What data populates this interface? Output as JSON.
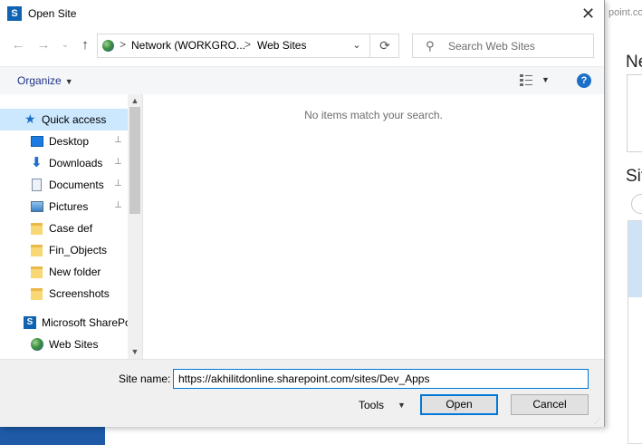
{
  "background": {
    "url_fragment": "point.co",
    "heading_1": "Ne",
    "heading_2": "Sit"
  },
  "dialog": {
    "title": "Open Site",
    "close_glyph": "✕"
  },
  "navigation": {
    "back_glyph": "←",
    "forward_glyph": "→",
    "recent_glyph": "⌄",
    "up_glyph": "↑",
    "breadcrumbs": [
      "Network (WORKGRO...",
      "Web Sites"
    ],
    "separator": ">",
    "refresh_glyph": "⟳",
    "search_placeholder": "Search Web Sites"
  },
  "toolbar": {
    "organize_label": "Organize",
    "help_label": "?"
  },
  "sidebar": {
    "items": [
      {
        "label": "Quick access",
        "icon": "star-icon"
      },
      {
        "label": "Desktop",
        "icon": "desktop-icon"
      },
      {
        "label": "Downloads",
        "icon": "download-icon"
      },
      {
        "label": "Documents",
        "icon": "document-icon"
      },
      {
        "label": "Pictures",
        "icon": "pictures-icon"
      },
      {
        "label": "Case def",
        "icon": "folder-icon"
      },
      {
        "label": "Fin_Objects",
        "icon": "folder-icon"
      },
      {
        "label": "New folder",
        "icon": "folder-icon"
      },
      {
        "label": "Screenshots",
        "icon": "folder-icon"
      },
      {
        "label": "Microsoft SharePo",
        "icon": "sharepoint-icon"
      },
      {
        "label": "Web Sites",
        "icon": "globe-icon"
      }
    ],
    "pin_glyph": "📌"
  },
  "content": {
    "empty_message": "No items match your search."
  },
  "footer": {
    "site_name_label": "Site name:",
    "site_name_value": "https://akhilitdonline.sharepoint.com/sites/Dev_Apps",
    "tools_label": "Tools",
    "open_label": "Open",
    "cancel_label": "Cancel"
  },
  "colors": {
    "accent": "#0078d7",
    "selected_bg": "#cce8ff",
    "organize_text": "#1e3287",
    "taskbar_blue": "#1e5aa8"
  }
}
